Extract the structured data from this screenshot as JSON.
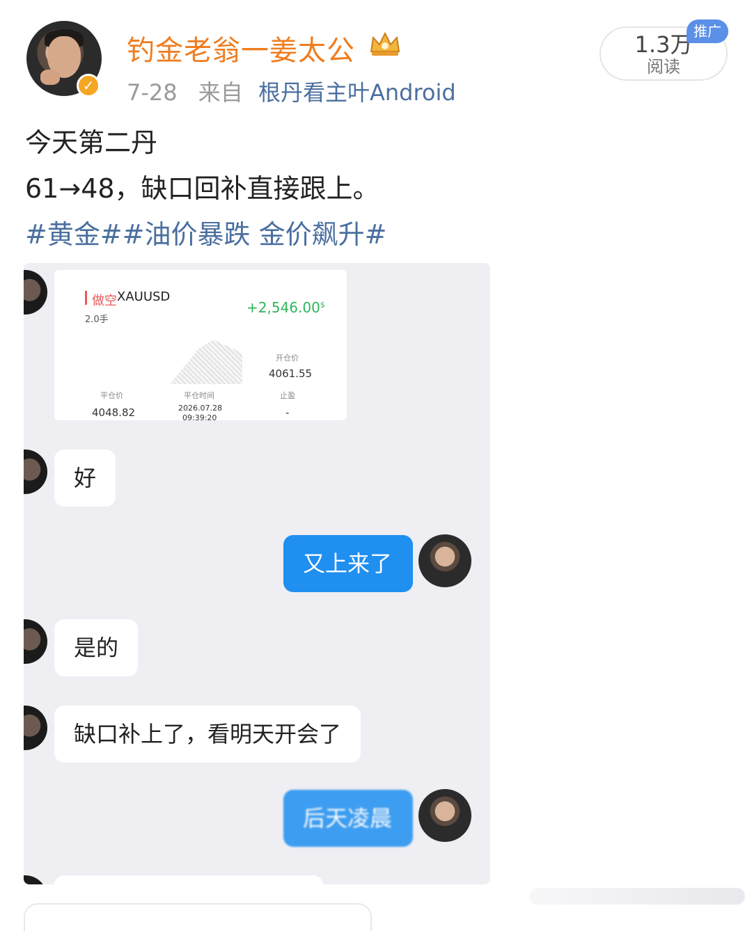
{
  "post": {
    "username": "钓金老翁一姜太公",
    "date": "7-28",
    "source_prefix": "来自",
    "device": "根丹看主叶Android",
    "reads_count": "1.3万",
    "reads_label": "阅读",
    "promo_tag": "推广",
    "lines": [
      "今天第二丹",
      "61→48，缺口回补直接跟上。"
    ],
    "hashtags": "#黄金##油价暴跌 金价飙升#"
  },
  "trade_card": {
    "side": "做空",
    "symbol": "XAUUSD",
    "lots": "2.0手",
    "profit": "+2,546.00",
    "currency": "$",
    "open_price_label": "开仓价",
    "open_price": "4061.55",
    "close_price_label": "平仓价",
    "close_price": "4048.82",
    "close_time_label": "平仓时间",
    "close_date": "2026.07.28",
    "close_time": "09:39:20",
    "take_profit_label": "止盈",
    "take_profit": "-"
  },
  "chat": {
    "messages": [
      {
        "from": "peer",
        "text": "好"
      },
      {
        "from": "me",
        "text": "又上来了"
      },
      {
        "from": "peer",
        "text": "是的"
      },
      {
        "from": "peer",
        "text": "缺口补上了，看明天开会了"
      },
      {
        "from": "me",
        "text": "后天凌晨"
      }
    ]
  },
  "colors": {
    "username": "#f07c1e",
    "link": "#4a6f9f",
    "out_bubble": "#1f8ff0",
    "profit_green": "#2fb55a",
    "short_red": "#e85a5a"
  }
}
